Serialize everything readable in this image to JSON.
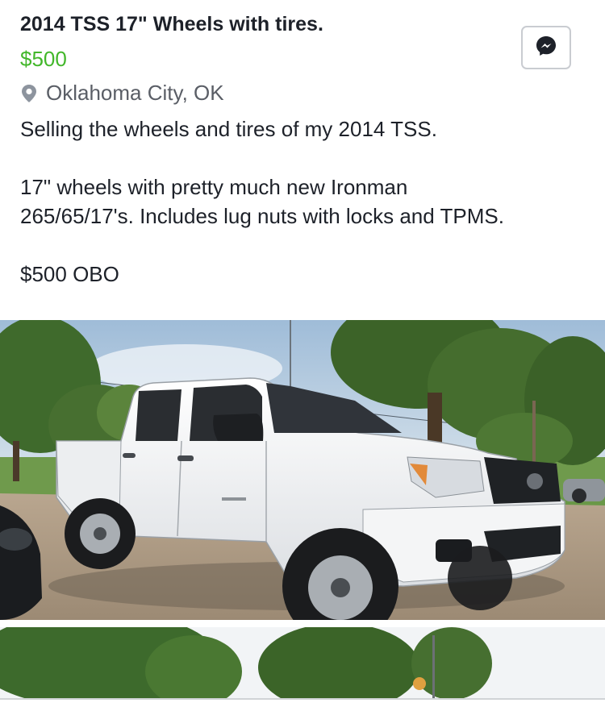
{
  "listing": {
    "title": "2014 TSS 17\" Wheels with tires.",
    "price": "$500",
    "location": "Oklahoma City, OK",
    "description": [
      "Selling the wheels and tires of my 2014 TSS.",
      "17\" wheels with pretty much new Ironman",
      "265/65/17's. Includes lug nuts with locks and TPMS.",
      "$500 OBO"
    ]
  },
  "icons": {
    "location": "map-pin-icon",
    "message": "messenger-icon"
  },
  "colors": {
    "price": "#42b72a",
    "title": "#1d2129",
    "location": "#5a5e66",
    "button_border": "#c9ccd1"
  }
}
